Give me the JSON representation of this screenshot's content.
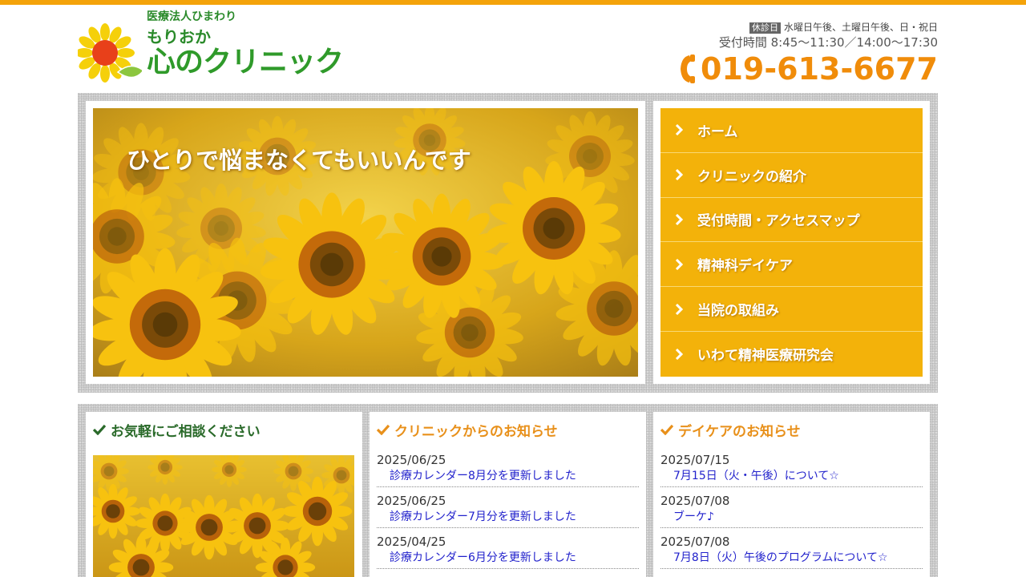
{
  "colors": {
    "accent_orange": "#f4a30a",
    "nav_yellow": "#f3b20a",
    "phone_orange": "#f08c0a",
    "logo_green": "#2f9a2a",
    "link_blue": "#2222cc"
  },
  "header": {
    "logo_subtitle": "医療法人ひまわり",
    "logo_pre": "もりおか",
    "logo_main": "心のクリニック",
    "closed_badge": "休診日",
    "closed_days": "水曜日午後、土曜日午後、日・祝日",
    "hours": "受付時間 8:45～11:30／14:00～17:30",
    "phone": "019-613-6677"
  },
  "hero": {
    "caption": "ひとりで悩まなくてもいいんです"
  },
  "nav": {
    "items": [
      {
        "label": "ホーム"
      },
      {
        "label": "クリニックの紹介"
      },
      {
        "label": "受付時間・アクセスマップ"
      },
      {
        "label": "精神科デイケア"
      },
      {
        "label": "当院の取組み"
      },
      {
        "label": "いわて精神医療研究会"
      }
    ]
  },
  "consult": {
    "title": "お気軽にご相談ください"
  },
  "clinic_news": {
    "title": "クリニックからのお知らせ",
    "items": [
      {
        "date": "2025/06/25",
        "text": "診療カレンダー8月分を更新しました"
      },
      {
        "date": "2025/06/25",
        "text": "診療カレンダー7月分を更新しました"
      },
      {
        "date": "2025/04/25",
        "text": "診療カレンダー6月分を更新しました"
      }
    ]
  },
  "daycare_news": {
    "title": "デイケアのお知らせ",
    "items": [
      {
        "date": "2025/07/15",
        "text": "7月15日（火・午後）について☆"
      },
      {
        "date": "2025/07/08",
        "text": "ブーケ♪"
      },
      {
        "date": "2025/07/08",
        "text": "7月8日（火）午後のプログラムについて☆"
      }
    ]
  }
}
